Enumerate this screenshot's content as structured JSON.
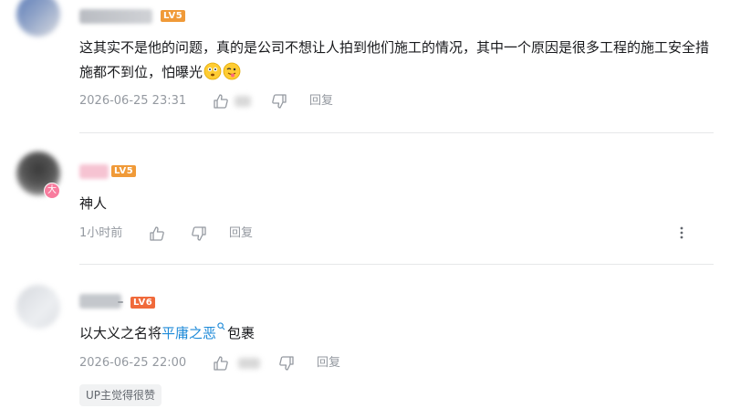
{
  "comments": [
    {
      "level": "LV5",
      "text": "这其实不是他的问题，真的是公司不想让人拍到他们施工的情况，其中一个原因是很多工程的施工安全措施都不到位，怕曝光",
      "time": "2026-06-25 23:31",
      "reply_label": "回复"
    },
    {
      "level": "LV5",
      "badge": "大",
      "text": "神人",
      "time": "1小时前",
      "reply_label": "回复"
    },
    {
      "level": "LV6",
      "text_before": "以大义之名将",
      "link_text": "平庸之恶",
      "text_after": "包裹",
      "time": "2026-06-25 22:00",
      "reply_label": "回复",
      "up_tag": "UP主觉得很赞"
    }
  ],
  "colors": {
    "level5": "#f09a38",
    "level6": "#f06a3b",
    "link": "#1d8ad8",
    "meta": "#9499a0",
    "divider": "#e6e7e9"
  }
}
